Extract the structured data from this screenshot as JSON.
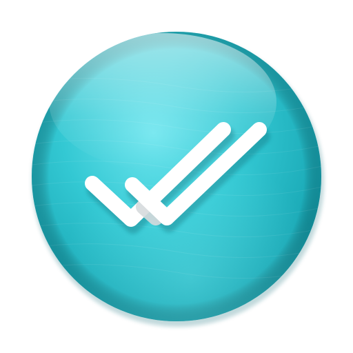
{
  "icon": {
    "name": "double-checkmark-icon",
    "description_label": "",
    "colors": {
      "background": "#ffffff",
      "circle_light": "#5fe0ea",
      "circle_mid": "#2cc4d0",
      "circle_dark": "#169fad",
      "rim_shadow": "#0e7f8c",
      "check": "#ffffff",
      "check_shadow": "#d9dde0"
    }
  }
}
